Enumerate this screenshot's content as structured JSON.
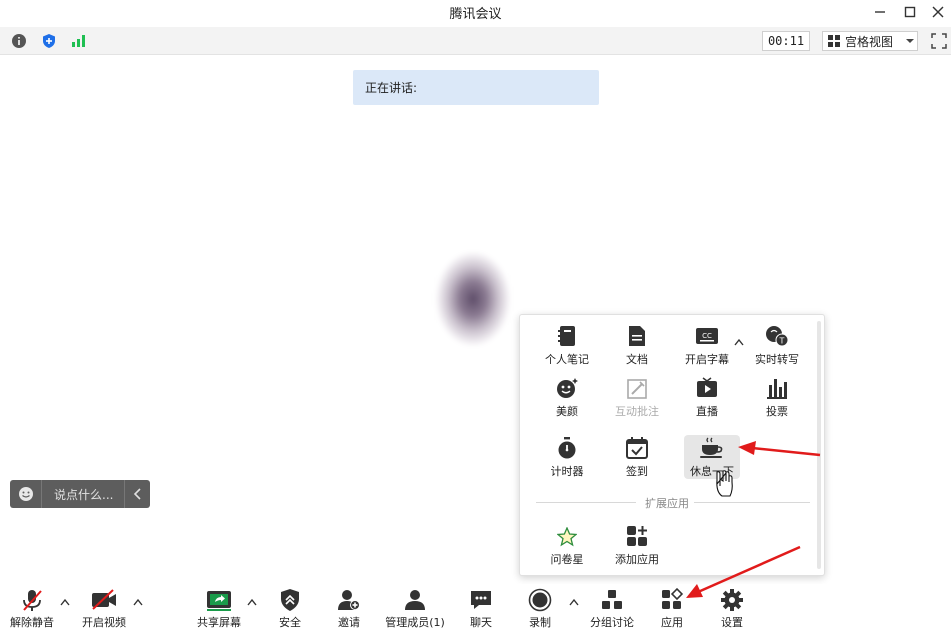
{
  "window": {
    "title": "腾讯会议",
    "controls": [
      "minimize-icon",
      "maximize-icon",
      "close-icon"
    ]
  },
  "infobar": {
    "icons": [
      "info-icon",
      "shield-icon",
      "signal-icon"
    ],
    "timer": "00:11",
    "view_label": "宫格视图"
  },
  "speaking": {
    "label": "正在讲话:"
  },
  "chat": {
    "placeholder": "说点什么..."
  },
  "app_panel": {
    "apps": [
      {
        "label": "个人笔记",
        "icon": "notebook-icon"
      },
      {
        "label": "文档",
        "icon": "document-icon"
      },
      {
        "label": "开启字幕",
        "icon": "captions-icon"
      },
      {
        "label": "实时转写",
        "icon": "transcribe-icon"
      },
      {
        "label": "美颜",
        "icon": "beauty-icon"
      },
      {
        "label": "互动批注",
        "icon": "annotate-icon"
      },
      {
        "label": "直播",
        "icon": "live-icon"
      },
      {
        "label": "投票",
        "icon": "vote-icon"
      },
      {
        "label": "计时器",
        "icon": "stopwatch-icon"
      },
      {
        "label": "签到",
        "icon": "checkin-icon"
      },
      {
        "label": "休息一下",
        "icon": "coffee-icon"
      }
    ],
    "section_label": "扩展应用",
    "extensions": [
      {
        "label": "问卷星",
        "icon": "star-icon"
      },
      {
        "label": "添加应用",
        "icon": "add-app-icon"
      }
    ]
  },
  "toolbar": {
    "unmute": "解除静音",
    "video": "开启视频",
    "share": "共享屏幕",
    "security": "安全",
    "invite": "邀请",
    "members": "管理成员(1)",
    "chat": "聊天",
    "record": "录制",
    "breakout": "分组讨论",
    "apps": "应用",
    "settings": "设置"
  },
  "colors": {
    "speaking_bg": "#dbe8f8",
    "accent_blue": "#1e6fe8",
    "signal_green": "#1fbf52",
    "annotation_red": "#e11b1b",
    "share_green": "#1a9b4a"
  }
}
